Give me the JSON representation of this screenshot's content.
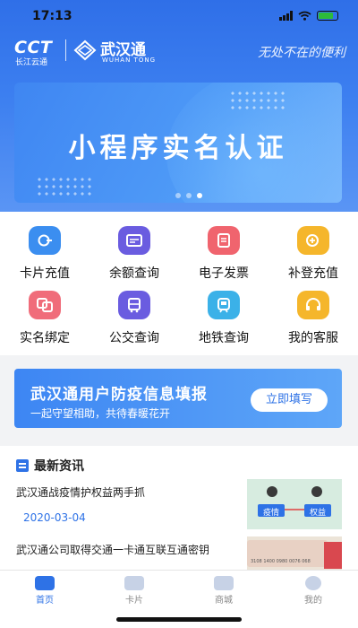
{
  "status": {
    "time": "17:13"
  },
  "header": {
    "cct_logo": "CCT",
    "cct_sub": "长江云通",
    "app_name": "武汉通",
    "app_name_en": "WUHAN TONG",
    "slogan": "无处不在的便利"
  },
  "banner": {
    "title": "小程序实名认证",
    "page_count": 3,
    "active_page": 3
  },
  "services": [
    {
      "label": "卡片充值",
      "icon": "card-recharge-icon",
      "color": "#3b8ef0"
    },
    {
      "label": "余额查询",
      "icon": "balance-icon",
      "color": "#6a5ce0"
    },
    {
      "label": "电子发票",
      "icon": "invoice-icon",
      "color": "#f0646e"
    },
    {
      "label": "补登充值",
      "icon": "top-up-icon",
      "color": "#f5b62b"
    },
    {
      "label": "实名绑定",
      "icon": "bind-icon",
      "color": "#f06c7a"
    },
    {
      "label": "公交查询",
      "icon": "bus-icon",
      "color": "#6a5ce0"
    },
    {
      "label": "地铁查询",
      "icon": "metro-icon",
      "color": "#3bb1e8"
    },
    {
      "label": "我的客服",
      "icon": "headset-icon",
      "color": "#f5b62b"
    }
  ],
  "epidemic": {
    "title": "武汉通用户防疫信息填报",
    "subtitle": "一起守望相助，共待春暖花开",
    "button": "立即填写"
  },
  "news": {
    "heading": "最新资讯",
    "items": [
      {
        "title": "武汉通战疫情护权益两手抓",
        "date": "2020-03-04",
        "thumb_labels": [
          "疫情",
          "权益"
        ]
      },
      {
        "title": "武汉通公司取得交通一卡通互联互通密钥",
        "date": "",
        "thumb_labels": [
          "3108 1400 0980 0076 068"
        ]
      }
    ]
  },
  "tabs": [
    {
      "label": "首页",
      "icon": "home-icon",
      "active": true
    },
    {
      "label": "卡片",
      "icon": "card-icon",
      "active": false
    },
    {
      "label": "商城",
      "icon": "shop-icon",
      "active": false
    },
    {
      "label": "我的",
      "icon": "profile-icon",
      "active": false
    }
  ]
}
